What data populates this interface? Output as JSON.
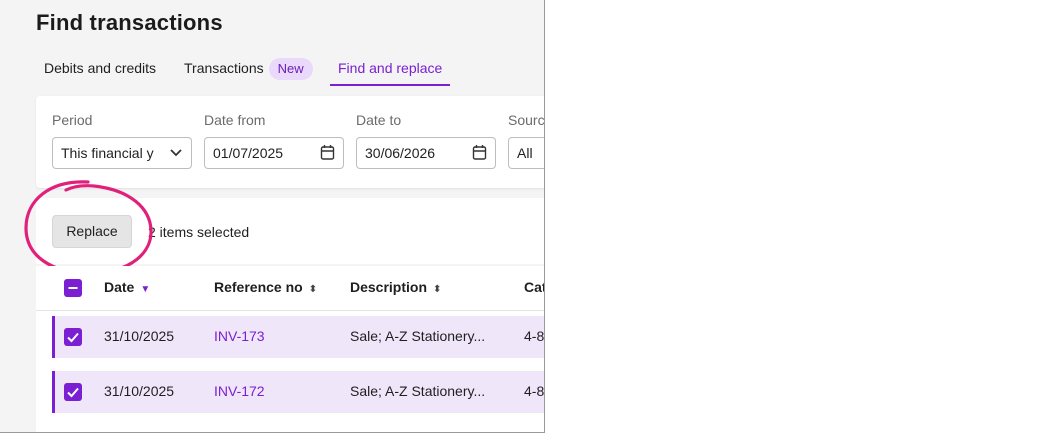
{
  "page": {
    "title": "Find transactions"
  },
  "tabs": [
    {
      "label": "Debits and credits"
    },
    {
      "label": "Transactions",
      "badge": "New"
    },
    {
      "label": "Find and replace",
      "active": true
    }
  ],
  "filters": {
    "period": {
      "label": "Period",
      "value": "This financial y"
    },
    "date_from": {
      "label": "Date from",
      "value": "01/07/2025"
    },
    "date_to": {
      "label": "Date to",
      "value": "30/06/2026"
    },
    "source": {
      "label": "Sourc",
      "value": "All"
    }
  },
  "selection": {
    "replace_label": "Replace",
    "selected_text": "2 items selected"
  },
  "table": {
    "headers": {
      "date": "Date",
      "reference": "Reference no",
      "description": "Description",
      "category": "Cat"
    },
    "rows": [
      {
        "date": "31/10/2025",
        "reference": "INV-173",
        "description": "Sale; A-Z Stationery...",
        "category": "4-8"
      },
      {
        "date": "31/10/2025",
        "reference": "INV-172",
        "description": "Sale; A-Z Stationery...",
        "category": "4-8"
      }
    ]
  },
  "colors": {
    "accent": "#7a1fd1",
    "row_highlight": "#f0e6fa",
    "annotation_ring": "#e0207a"
  },
  "icons": {
    "dropdown": "chevron-down-icon",
    "calendar": "calendar-icon",
    "sort": "sort-icon"
  }
}
